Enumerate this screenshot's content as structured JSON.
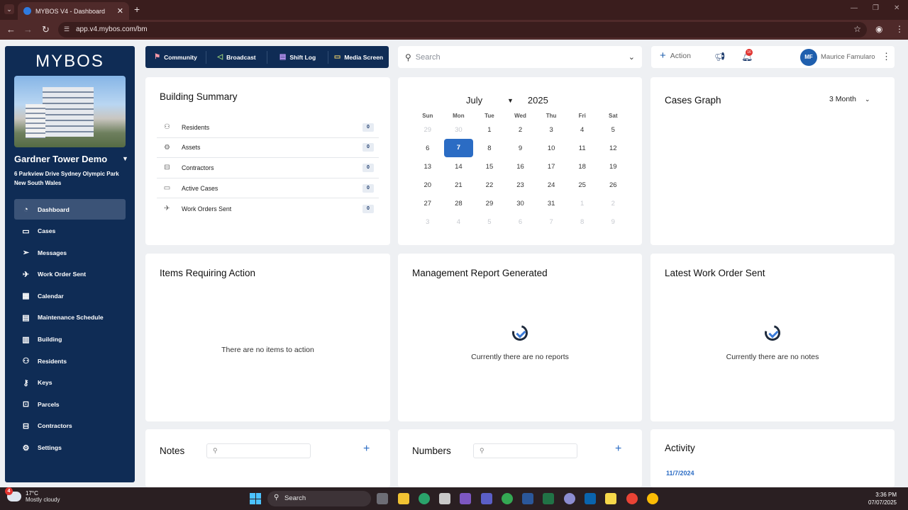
{
  "browser": {
    "tab_title": "MYBOS V4 - Dashboard",
    "url": "app.v4.mybos.com/bm"
  },
  "sidebar": {
    "logo": "MYBOS",
    "building_name": "Gardner Tower Demo",
    "building_address": "6 Parkview Drive Sydney Olympic Park New South Wales",
    "items": [
      {
        "label": "Dashboard",
        "icon": "dashboard-icon"
      },
      {
        "label": "Cases",
        "icon": "briefcase-icon"
      },
      {
        "label": "Messages",
        "icon": "send-icon"
      },
      {
        "label": "Work Order Sent",
        "icon": "paper-plane-icon"
      },
      {
        "label": "Calendar",
        "icon": "calendar-icon"
      },
      {
        "label": "Maintenance Schedule",
        "icon": "maintenance-calendar-icon"
      },
      {
        "label": "Building",
        "icon": "building-icon"
      },
      {
        "label": "Residents",
        "icon": "users-icon"
      },
      {
        "label": "Keys",
        "icon": "key-icon"
      },
      {
        "label": "Parcels",
        "icon": "parcel-icon"
      },
      {
        "label": "Contractors",
        "icon": "contractor-icon"
      },
      {
        "label": "Settings",
        "icon": "settings-icon"
      }
    ]
  },
  "topnav": {
    "items": [
      {
        "label": "Community",
        "icon": "community-icon"
      },
      {
        "label": "Broadcast",
        "icon": "megaphone-icon"
      },
      {
        "label": "Shift Log",
        "icon": "log-icon"
      },
      {
        "label": "Media Screen",
        "icon": "screen-icon"
      }
    ]
  },
  "search": {
    "placeholder": "Search"
  },
  "header": {
    "action_label": "Action",
    "notification_count": "16",
    "user_initials": "MF",
    "user_name": "Maurice Famularo"
  },
  "building_summary": {
    "title": "Building Summary",
    "rows": [
      {
        "label": "Residents",
        "count": "0"
      },
      {
        "label": "Assets",
        "count": "0"
      },
      {
        "label": "Contractors",
        "count": "0"
      },
      {
        "label": "Active Cases",
        "count": "0"
      },
      {
        "label": "Work Orders Sent",
        "count": "0"
      }
    ]
  },
  "calendar": {
    "month": "July",
    "year": "2025",
    "weekdays": [
      "Sun",
      "Mon",
      "Tue",
      "Wed",
      "Thu",
      "Fri",
      "Sat"
    ],
    "weeks": [
      [
        "29",
        "30",
        "1",
        "2",
        "3",
        "4",
        "5"
      ],
      [
        "6",
        "7",
        "8",
        "9",
        "10",
        "11",
        "12"
      ],
      [
        "13",
        "14",
        "15",
        "16",
        "17",
        "18",
        "19"
      ],
      [
        "20",
        "21",
        "22",
        "23",
        "24",
        "25",
        "26"
      ],
      [
        "27",
        "28",
        "29",
        "30",
        "31",
        "1",
        "2"
      ],
      [
        "3",
        "4",
        "5",
        "6",
        "7",
        "8",
        "9"
      ]
    ],
    "selected": "7"
  },
  "cases_graph": {
    "title": "Cases Graph",
    "range": "3 Month"
  },
  "items_action": {
    "title": "Items Requiring Action",
    "empty": "There are no items to action"
  },
  "mgmt_report": {
    "title": "Management Report Generated",
    "empty": "Currently there are no reports"
  },
  "latest_wo": {
    "title": "Latest Work Order Sent",
    "empty": "Currently there are no notes"
  },
  "notes": {
    "title": "Notes"
  },
  "numbers": {
    "title": "Numbers"
  },
  "activity": {
    "title": "Activity",
    "date": "11/7/2024"
  },
  "taskbar": {
    "weather_temp": "17°C",
    "weather_desc": "Mostly cloudy",
    "weather_badge": "4",
    "search_label": "Search",
    "time": "3:36 PM",
    "date": "07/07/2025"
  }
}
